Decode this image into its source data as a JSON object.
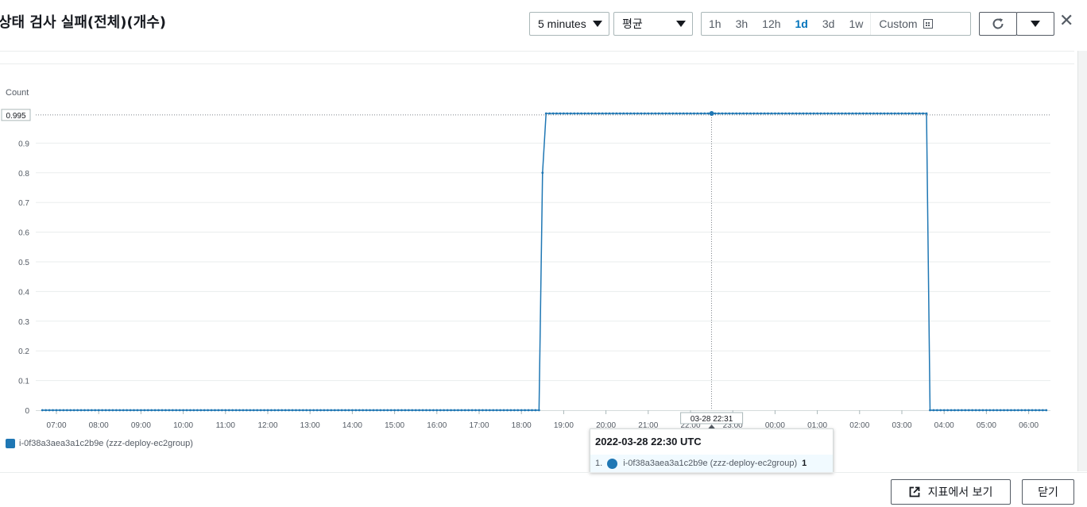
{
  "header": {
    "title": "상태 검사 실패(전체)(개수)",
    "period": "5 minutes",
    "statistic": "평균",
    "ranges": [
      "1h",
      "3h",
      "12h",
      "1d",
      "3d",
      "1w"
    ],
    "active_range": "1d",
    "custom_label": "Custom",
    "icons": {
      "calendar": "calendar-icon",
      "refresh": "refresh-icon",
      "dropdown": "chevron-down-icon",
      "close": "close-icon"
    },
    "close_glyph": "✕"
  },
  "chart_data": {
    "type": "line",
    "ylabel": "Count",
    "ylim": [
      0,
      1
    ],
    "y_ticks": [
      "0",
      "0.1",
      "0.2",
      "0.3",
      "0.4",
      "0.5",
      "0.6",
      "0.7",
      "0.8",
      "0.9"
    ],
    "y_marker_label": "0.995",
    "x_ticks": [
      "07:00",
      "08:00",
      "09:00",
      "10:00",
      "11:00",
      "12:00",
      "13:00",
      "14:00",
      "15:00",
      "16:00",
      "17:00",
      "18:00",
      "19:00",
      "20:00",
      "21:00",
      "22:00",
      "23:00",
      "00:00",
      "01:00",
      "02:00",
      "03:00",
      "04:00",
      "05:00",
      "06:00"
    ],
    "x_cursor_label": "03-28 22:31",
    "grid": true,
    "legend_position": "bottom-left",
    "series": [
      {
        "name": "i-0f38a3aea3a1c2b9e (zzz-deploy-ec2group)",
        "color": "#1f77b4",
        "points": [
          [
            "06:40",
            0
          ],
          [
            "18:25",
            0
          ],
          [
            "18:30",
            0.8
          ],
          [
            "18:35",
            1
          ],
          [
            "03:35",
            1
          ],
          [
            "03:40",
            0
          ],
          [
            "06:25",
            0
          ]
        ]
      }
    ]
  },
  "tooltip": {
    "title": "2022-03-28 22:30 UTC",
    "index": "1.",
    "series_name": "i-0f38a3aea3a1c2b9e (zzz-deploy-ec2group)",
    "value": "1"
  },
  "footer": {
    "view_metric_label": "지표에서 보기",
    "close_label": "닫기"
  }
}
